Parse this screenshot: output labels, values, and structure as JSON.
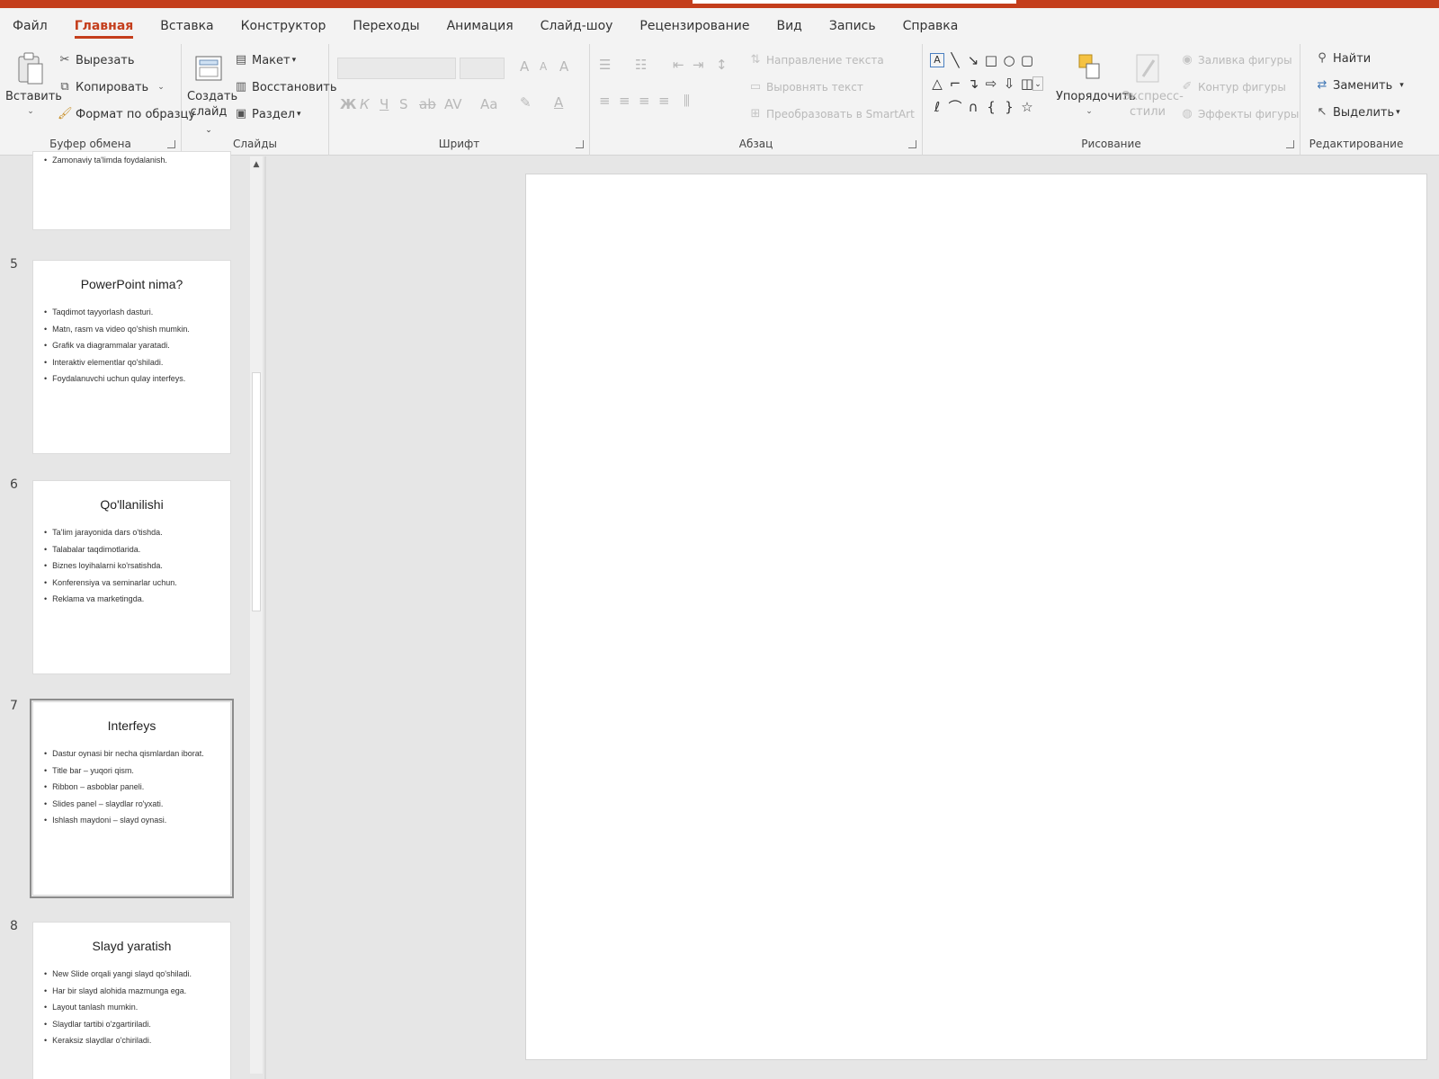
{
  "tabs": [
    "Файл",
    "Главная",
    "Вставка",
    "Конструктор",
    "Переходы",
    "Анимация",
    "Слайд-шоу",
    "Рецензирование",
    "Вид",
    "Запись",
    "Справка"
  ],
  "active_tab": "Главная",
  "clipboard": {
    "paste": "Вставить",
    "cut": "Вырезать",
    "copy": "Копировать",
    "format_painter": "Формат по образцу",
    "label": "Буфер обмена"
  },
  "slides_group": {
    "new_slide_1": "Создать",
    "new_slide_2": "слайд",
    "layout": "Макет",
    "reset": "Восстановить",
    "section": "Раздел",
    "label": "Слайды"
  },
  "font_group": {
    "bold": "Ж",
    "italic": "К",
    "underline": "Ч",
    "shadow": "S",
    "strike": "ab",
    "spacing": "AV",
    "case": "Aa",
    "label": "Шрифт"
  },
  "paragraph_group": {
    "text_direction": "Направление текста",
    "align_text": "Выровнять текст",
    "smartart": "Преобразовать в SmartArt",
    "label": "Абзац"
  },
  "drawing_group": {
    "arrange": "Упорядочить",
    "quick_styles_1": "Экспресс-",
    "quick_styles_2": "стили",
    "shape_fill": "Заливка фигуры",
    "shape_outline": "Контур фигуры",
    "shape_effects": "Эффекты фигуры",
    "label": "Рисование"
  },
  "editing_group": {
    "find": "Найти",
    "replace": "Заменить",
    "select": "Выделить",
    "label": "Редактирование"
  },
  "slides": [
    {
      "number": "",
      "title": "",
      "bullets": [
        "Zamonaviy ta'limda foydalanish."
      ]
    },
    {
      "number": "5",
      "title": "PowerPoint nima?",
      "bullets": [
        "Taqdimot tayyorlash dasturi.",
        "Matn, rasm va video qo'shish mumkin.",
        "Grafik va diagrammalar yaratadi.",
        "Interaktiv elementlar qo'shiladi.",
        "Foydalanuvchi uchun qulay interfeys."
      ]
    },
    {
      "number": "6",
      "title": "Qo'llanilishi",
      "bullets": [
        "Ta'lim jarayonida dars o'tishda.",
        "Talabalar taqdimotlarida.",
        "Biznes loyihalarni ko'rsatishda.",
        "Konferensiya va seminarlar uchun.",
        "Reklama va marketingda."
      ]
    },
    {
      "number": "7",
      "title": "Interfeys",
      "bullets": [
        "Dastur oynasi bir necha qismlardan iborat.",
        "Title bar – yuqori qism.",
        "Ribbon – asboblar paneli.",
        "Slides panel – slaydlar ro'yxati.",
        "Ishlash maydoni – slayd oynasi."
      ]
    },
    {
      "number": "8",
      "title": "Slayd yaratish",
      "bullets": [
        "New Slide orqali yangi slayd qo'shiladi.",
        "Har bir slayd alohida mazmunga ega.",
        "Layout tanlash mumkin.",
        "Slaydlar tartibi o'zgartiriladi.",
        "Keraksiz slaydlar o'chiriladi."
      ]
    }
  ],
  "selected_slide": "7",
  "colors": {
    "accent": "#c43e1c",
    "ribbon_bg": "#f3f3f3",
    "workspace_bg": "#e6e6e6"
  },
  "icons": {
    "cut": "scissors-icon",
    "copy": "copy-icon",
    "format_painter": "brush-icon",
    "find": "magnifier-icon",
    "replace": "replace-icon",
    "select": "cursor-icon"
  }
}
